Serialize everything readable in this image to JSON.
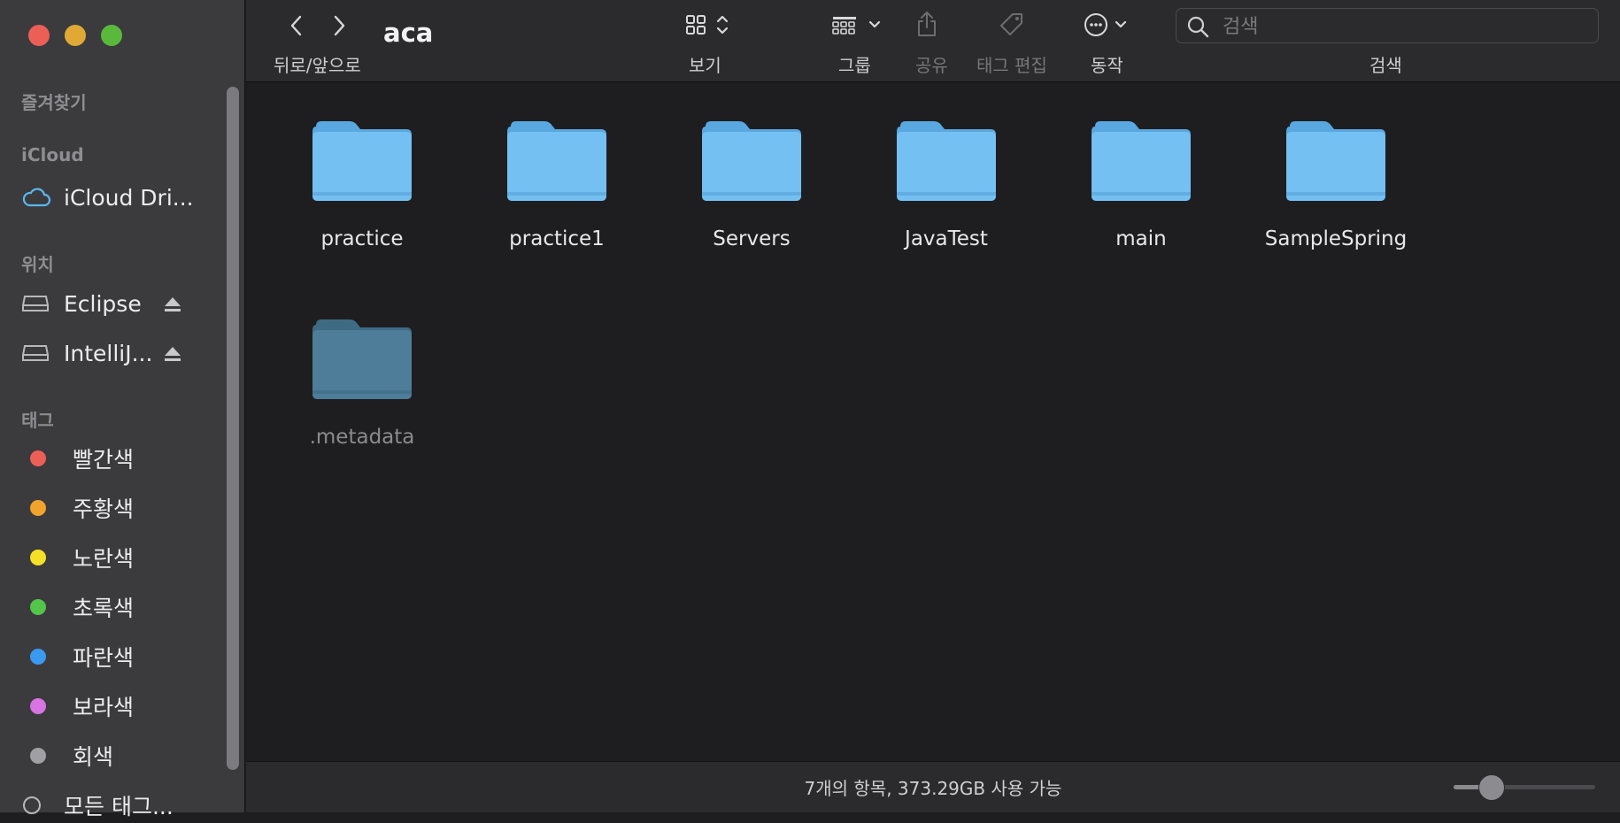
{
  "window": {
    "title": "aca"
  },
  "sidebar": {
    "sections": {
      "favorites": "즐겨찾기",
      "icloud": "iCloud",
      "locations": "위치",
      "tags": "태그"
    },
    "icloud_items": [
      {
        "label": "iCloud Dri...",
        "icon": "cloud-icon"
      }
    ],
    "location_items": [
      {
        "label": "Eclipse",
        "icon": "drive-icon"
      },
      {
        "label": "IntelliJ...",
        "icon": "drive-icon"
      }
    ],
    "tag_items": [
      {
        "label": "빨간색",
        "color": "#ec5f57"
      },
      {
        "label": "주황색",
        "color": "#f0a42c"
      },
      {
        "label": "노란색",
        "color": "#f5e028"
      },
      {
        "label": "초록색",
        "color": "#52c54a"
      },
      {
        "label": "파란색",
        "color": "#3a9af0"
      },
      {
        "label": "보라색",
        "color": "#d874e3"
      },
      {
        "label": "회색",
        "color": "#a0a0a4"
      }
    ],
    "all_tags": "모든 태그..."
  },
  "toolbar": {
    "back_forward_label": "뒤로/앞으로",
    "view_label": "보기",
    "group_label": "그룹",
    "share_label": "공유",
    "edit_tags_label": "태그 편집",
    "action_label": "동작",
    "search_label": "검색",
    "search_placeholder": "검색"
  },
  "files": [
    {
      "name": "practice",
      "hidden": false
    },
    {
      "name": "practice1",
      "hidden": false
    },
    {
      "name": "Servers",
      "hidden": false
    },
    {
      "name": "JavaTest",
      "hidden": false
    },
    {
      "name": "main",
      "hidden": false
    },
    {
      "name": "SampleSpring",
      "hidden": false
    },
    {
      "name": ".metadata",
      "hidden": true
    }
  ],
  "status": {
    "text": "7개의 항목, 373.29GB 사용 가능"
  },
  "icon_size_slider": {
    "value_fraction": 0.26
  },
  "colors": {
    "folder": "#74c0f2",
    "folder_hidden": "#4d7d99",
    "accent_cloud": "#5ab8f0"
  }
}
